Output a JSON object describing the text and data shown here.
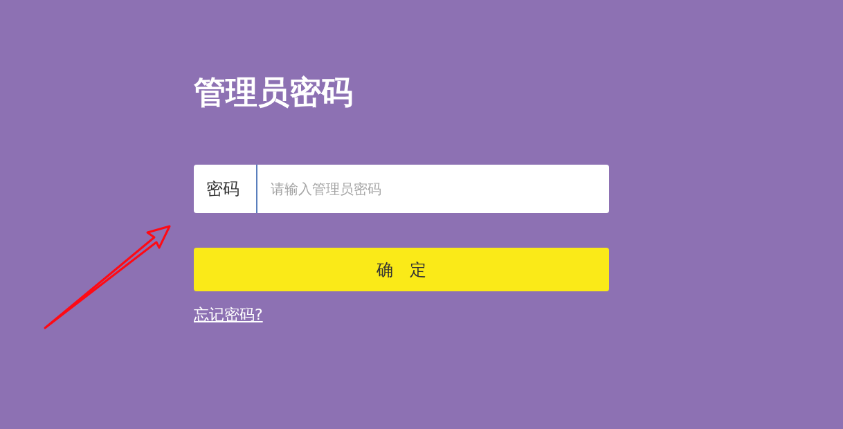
{
  "title": "管理员密码",
  "password_field": {
    "label": "密码",
    "placeholder": "请输入管理员密码"
  },
  "confirm_button": {
    "label": "确　定"
  },
  "forgot_link": {
    "label": "忘记密码?"
  }
}
